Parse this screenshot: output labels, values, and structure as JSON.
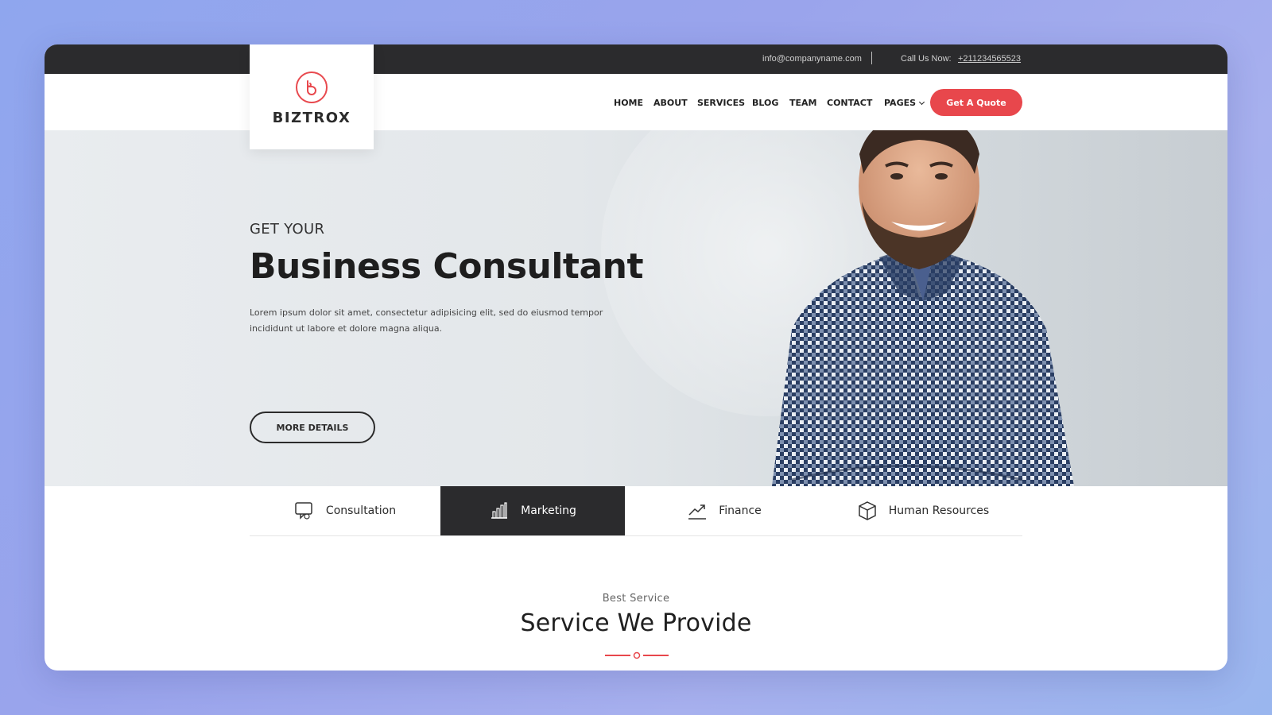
{
  "topbar": {
    "email": "info@companyname.com",
    "call_label": "Call Us Now:",
    "phone": "+211234565523"
  },
  "brand": {
    "name": "BIZTROX",
    "accent": "#e8474c"
  },
  "nav": {
    "items": [
      "HOME",
      "ABOUT",
      "SERVICES",
      "BLOG",
      "TEAM",
      "CONTACT",
      "PAGES"
    ],
    "cta": "Get A Quote"
  },
  "hero": {
    "eyebrow": "GET YOUR",
    "title": "Business Consultant",
    "description": "Lorem ipsum dolor sit amet, consectetur adipisicing elit, sed do eiusmod tempor incididunt ut labore et dolore magna aliqua.",
    "button": "MORE DETAILS"
  },
  "tabs": [
    {
      "label": "Consultation",
      "icon": "chat-icon",
      "active": false
    },
    {
      "label": "Marketing",
      "icon": "bar-chart-icon",
      "active": true
    },
    {
      "label": "Finance",
      "icon": "trend-up-icon",
      "active": false
    },
    {
      "label": "Human Resources",
      "icon": "box-icon",
      "active": false
    }
  ],
  "section": {
    "subtitle": "Best Service",
    "title": "Service We Provide"
  },
  "colors": {
    "dark": "#2b2b2d",
    "accent": "#e8474c",
    "background": "#9aa8ee"
  }
}
